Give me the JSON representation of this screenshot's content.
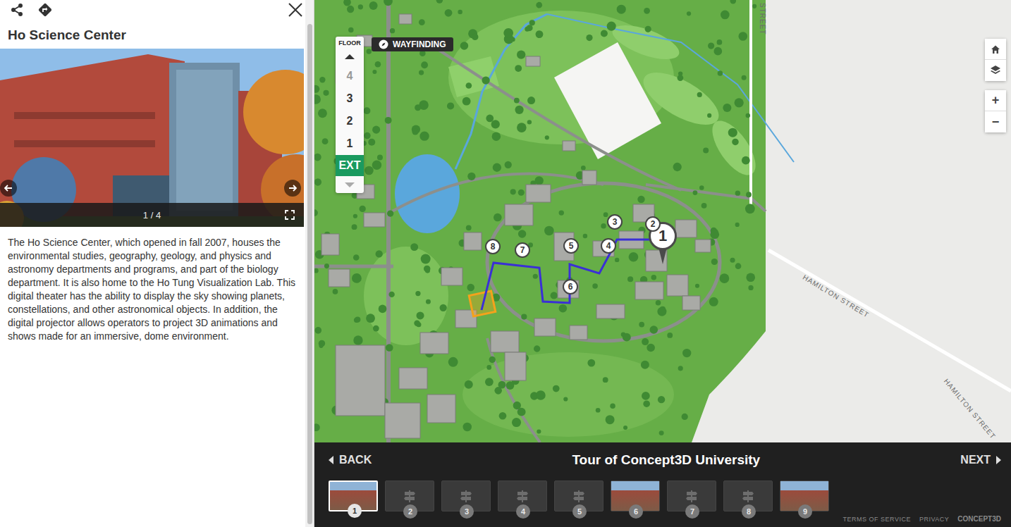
{
  "panel": {
    "title": "Ho Science Center",
    "photo": {
      "counter": "1 / 4"
    },
    "description": "The Ho Science Center, which opened in fall 2007, houses the environmental studies, geography, geology, and physics and astronomy departments and programs, and part of the biology department. It is also home to the Ho Tung Visualization Lab. This digital theater has the ability to display the sky showing planets, constellations, and other astronomical objects. In addition, the digital projector allows operators to project 3D animations and shows made for an immersive, dome environment."
  },
  "floor_picker": {
    "label": "FLOOR",
    "up_disabled": false,
    "down_disabled": true,
    "floors": [
      {
        "label": "4",
        "selected": false,
        "disabled": true
      },
      {
        "label": "3",
        "selected": false,
        "disabled": false
      },
      {
        "label": "2",
        "selected": false,
        "disabled": false
      },
      {
        "label": "1",
        "selected": false,
        "disabled": false
      },
      {
        "label": "EXT",
        "selected": true,
        "disabled": false
      }
    ]
  },
  "wayfinding": {
    "label": "WAYFINDING"
  },
  "map_controls": {
    "zoom_in": "+",
    "zoom_out": "−"
  },
  "map": {
    "street_labels": [
      {
        "text": "HAMILTON STREET"
      },
      {
        "text": "HAMILTON STREET"
      },
      {
        "text": "STREET"
      }
    ],
    "stops": [
      {
        "label": "1",
        "selected": true
      },
      {
        "label": "2",
        "selected": false
      },
      {
        "label": "3",
        "selected": false
      },
      {
        "label": "4",
        "selected": false
      },
      {
        "label": "5",
        "selected": false
      },
      {
        "label": "6",
        "selected": false
      },
      {
        "label": "7",
        "selected": false
      },
      {
        "label": "8",
        "selected": false
      }
    ]
  },
  "tour": {
    "back": "BACK",
    "title": "Tour of Concept3D University",
    "next": "NEXT",
    "thumbnails": [
      {
        "number": "1",
        "kind": "photo",
        "selected": true
      },
      {
        "number": "2",
        "kind": "placeholder",
        "selected": false
      },
      {
        "number": "3",
        "kind": "placeholder",
        "selected": false
      },
      {
        "number": "4",
        "kind": "placeholder",
        "selected": false
      },
      {
        "number": "5",
        "kind": "placeholder",
        "selected": false
      },
      {
        "number": "6",
        "kind": "photo",
        "selected": false
      },
      {
        "number": "7",
        "kind": "placeholder",
        "selected": false
      },
      {
        "number": "8",
        "kind": "placeholder",
        "selected": false
      },
      {
        "number": "9",
        "kind": "photo",
        "selected": false
      }
    ]
  },
  "footer": {
    "links": [
      "TERMS OF SERVICE",
      "PRIVACY"
    ],
    "brand": "CONCEPT3D"
  }
}
